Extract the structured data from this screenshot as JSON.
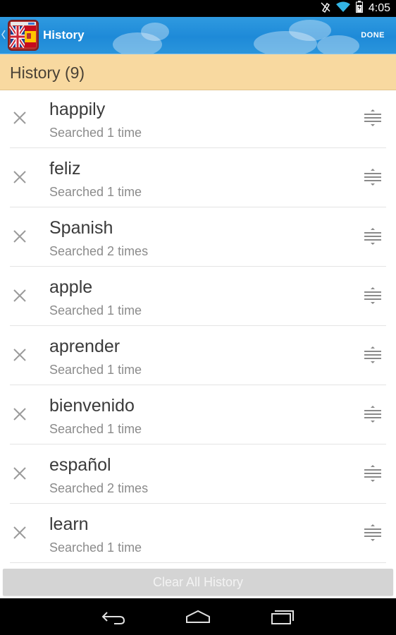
{
  "status_bar": {
    "time": "4:05",
    "icons": [
      "notification-muted-icon",
      "wifi-icon",
      "battery-icon"
    ]
  },
  "action_bar": {
    "title": "History",
    "done_label": "DONE",
    "logo": "uk-spain-dictionary-logo"
  },
  "section": {
    "title": "History (9)"
  },
  "history": {
    "items": [
      {
        "word": "happily",
        "count": "Searched 1 time"
      },
      {
        "word": "feliz",
        "count": "Searched 1 time"
      },
      {
        "word": "Spanish",
        "count": "Searched 2 times"
      },
      {
        "word": "apple",
        "count": "Searched 1 time"
      },
      {
        "word": "aprender",
        "count": "Searched 1 time"
      },
      {
        "word": "bienvenido",
        "count": "Searched 1 time"
      },
      {
        "word": "español",
        "count": "Searched 2 times"
      },
      {
        "word": "learn",
        "count": "Searched 1 time"
      }
    ]
  },
  "clear_button": {
    "label": "Clear All History"
  },
  "nav_bar": {
    "buttons": [
      "back-icon",
      "home-icon",
      "recent-apps-icon"
    ]
  },
  "colors": {
    "action_bar": "#1e8ad8",
    "section_header": "#f8d9a0",
    "word_text": "#3a3a3a",
    "count_text": "#8b8b8b"
  }
}
